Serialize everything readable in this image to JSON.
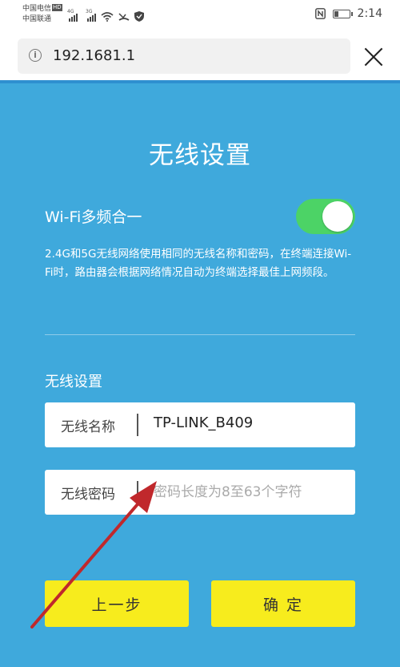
{
  "status_bar": {
    "carrier_1": "中国电信",
    "carrier_1_badge": "HD",
    "carrier_2": "中国联通",
    "sim1_net": "4G",
    "sim2_net": "3G",
    "time": "2:14",
    "battery_level": 0.35
  },
  "browser": {
    "url": "192.1681.1"
  },
  "page": {
    "title": "无线设置",
    "wifi_merge": {
      "label": "Wi-Fi多频合一",
      "enabled": true,
      "description": "2.4G和5G无线网络使用相同的无线名称和密码，在终端连接Wi-Fi时，路由器会根据网络情况自动为终端选择最佳上网频段。"
    },
    "section_title": "无线设置",
    "ssid_field": {
      "label": "无线名称",
      "value": "TP-LINK_B409"
    },
    "password_field": {
      "label": "无线密码",
      "placeholder": "密码长度为8至63个字符",
      "value": ""
    },
    "buttons": {
      "prev": "上一步",
      "confirm": "确 定"
    }
  },
  "colors": {
    "background": "#3fa9dc",
    "toggle_on": "#4cd366",
    "button": "#f7ec1d",
    "arrow": "#c0282c"
  }
}
